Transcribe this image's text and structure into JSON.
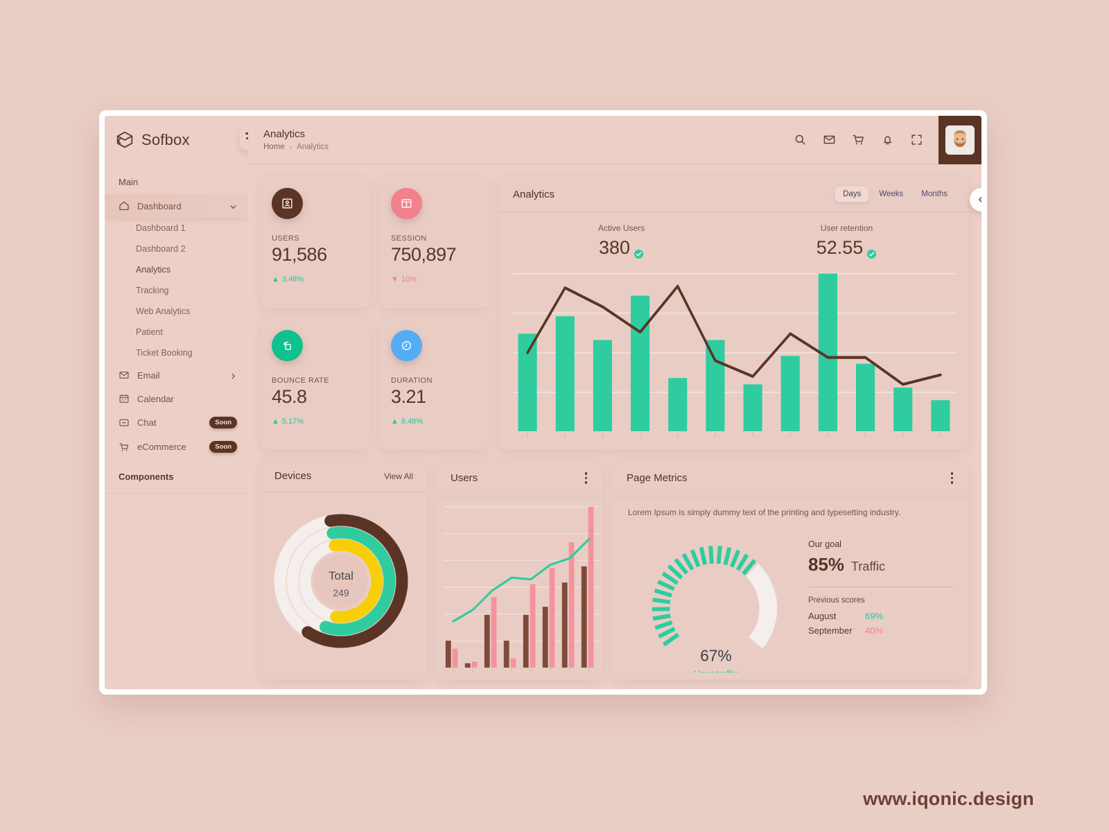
{
  "brand": {
    "name": "Sofbox",
    "logo_icon": "sofbox-logo-icon",
    "collapse_icon": "menu-collapse-icon"
  },
  "sidebar": {
    "section_main": "Main",
    "section_components": "Components",
    "dashboard": {
      "label": "Dashboard",
      "icon": "home-icon",
      "chevron": "chevron-down-icon"
    },
    "sub_items": [
      {
        "label": "Dashboard 1"
      },
      {
        "label": "Dashboard 2"
      },
      {
        "label": "Analytics"
      },
      {
        "label": "Tracking"
      },
      {
        "label": "Web Analytics"
      },
      {
        "label": "Patient"
      },
      {
        "label": "Ticket Booking"
      }
    ],
    "items": [
      {
        "label": "Email",
        "icon": "mail-icon",
        "chevron": "chevron-right-icon",
        "badge": ""
      },
      {
        "label": "Calendar",
        "icon": "calendar-icon",
        "chevron": "",
        "badge": ""
      },
      {
        "label": "Chat",
        "icon": "chat-icon",
        "chevron": "",
        "badge": "Soon"
      },
      {
        "label": "eCommerce",
        "icon": "cart-icon",
        "chevron": "",
        "badge": "Soon"
      }
    ]
  },
  "header": {
    "title": "Analytics",
    "breadcrumb_home": "Home",
    "breadcrumb_sep": "›",
    "breadcrumb_current": "Analytics",
    "icons": [
      "search-icon",
      "mail-icon",
      "cart-icon",
      "bell-icon",
      "fullscreen-icon"
    ],
    "avatar": "user-avatar"
  },
  "kpis": [
    {
      "label": "USERS",
      "value": "91,586",
      "delta": "3.48%",
      "direction": "up",
      "icon": "contact-card-icon",
      "color": "#5b3426"
    },
    {
      "label": "SESSION",
      "value": "750,897",
      "delta": "10%",
      "direction": "down",
      "icon": "browser-window-icon",
      "color": "#f2808d"
    },
    {
      "label": "BOUNCE RATE",
      "value": "45.8",
      "delta": "5.17%",
      "direction": "up",
      "icon": "bounce-icon",
      "color": "#0fc18e"
    },
    {
      "label": "DURATION",
      "value": "3.21",
      "delta": "8.48%",
      "direction": "up",
      "icon": "clock-icon",
      "color": "#54acf5"
    }
  ],
  "analytics": {
    "title": "Analytics",
    "tabs": [
      {
        "label": "Days",
        "active": true
      },
      {
        "label": "Weeks",
        "active": false
      },
      {
        "label": "Months",
        "active": false
      }
    ],
    "active_users_label": "Active Users",
    "active_users_value": "380",
    "retention_label": "User retention",
    "retention_value": "52.55",
    "badge_icon": "check-circle-icon"
  },
  "devices": {
    "title": "Devices",
    "view_all": "View All",
    "center_label": "Total",
    "center_value": "249"
  },
  "users_card": {
    "title": "Users",
    "menu_icon": "kebab-menu-icon"
  },
  "page_metrics": {
    "title": "Page Metrics",
    "menu_icon": "kebab-menu-icon",
    "description": "Lorem Ipsum is simply dummy text of the printing and typesetting industry.",
    "gauge_value": "67%",
    "gauge_caption": "User traffic",
    "goal_label": "Our goal",
    "goal_pct": "85%",
    "goal_word": "Traffic",
    "previous_label": "Previous scores",
    "previous": [
      {
        "month": "August",
        "pct": "69%",
        "tone": "g"
      },
      {
        "month": "September",
        "pct": "40%",
        "tone": "r"
      }
    ]
  },
  "float_arrow_icon": "arrow-left-icon",
  "watermark": "www.iqonic.design",
  "colors": {
    "background": "#e9cec6",
    "panel": "#ecd0c8",
    "card": "#e9cdc5",
    "brown": "#5b3426",
    "green": "#2ecc9f",
    "pink": "#f2808d",
    "yellow": "#f6cf09",
    "blue": "#54acf5",
    "offwhite": "#f4eeec"
  },
  "chart_data": [
    {
      "type": "bar",
      "id": "analytics-main",
      "title": "Analytics",
      "categories": [
        "1",
        "2",
        "3",
        "4",
        "5",
        "6",
        "7",
        "8",
        "9",
        "10",
        "11",
        "12"
      ],
      "series": [
        {
          "name": "Bars",
          "type": "bar",
          "color": "#2ecc9f",
          "values": [
            62,
            73,
            58,
            86,
            34,
            58,
            30,
            48,
            100,
            43,
            28,
            20
          ]
        },
        {
          "name": "Trend",
          "type": "line",
          "color": "#5b3426",
          "values": [
            50,
            91,
            79,
            63,
            92,
            45,
            35,
            62,
            47,
            47,
            30,
            36
          ]
        }
      ],
      "ylim": [
        0,
        100
      ],
      "grid": true,
      "xlabel": "",
      "ylabel": "",
      "legend": "none"
    },
    {
      "type": "pie",
      "id": "devices-rings",
      "title": "Devices",
      "center_label": "Total",
      "center_value": 249,
      "rings": [
        {
          "name": "Outer",
          "color": "#5b3426",
          "track": "#f4eeec",
          "percent": 62
        },
        {
          "name": "Middle",
          "color": "#2ecc9f",
          "track": "#f4eeec",
          "percent": 58
        },
        {
          "name": "Inner",
          "color": "#f6cf09",
          "track": "#f4eeec",
          "percent": 55
        }
      ]
    },
    {
      "type": "bar",
      "id": "users-mini",
      "title": "Users",
      "categories": [
        "1",
        "2",
        "3",
        "4",
        "5",
        "6",
        "7",
        "8"
      ],
      "series": [
        {
          "name": "Brown bars",
          "type": "bar",
          "color": "#7d4b3a",
          "values": [
            17,
            3,
            33,
            17,
            33,
            38,
            53,
            63
          ]
        },
        {
          "name": "Pink bars",
          "type": "bar",
          "color": "#f4939d",
          "values": [
            12,
            4,
            44,
            6,
            52,
            62,
            78,
            100
          ]
        },
        {
          "name": "Line",
          "type": "line",
          "color": "#2ecc9f",
          "values": [
            29,
            36,
            48,
            56,
            55,
            64,
            68,
            80
          ]
        }
      ],
      "ylim": [
        0,
        100
      ],
      "grid": true
    },
    {
      "type": "pie",
      "id": "traffic-gauge",
      "title": "Page Metrics gauge",
      "value": 67,
      "unit": "%",
      "caption": "User traffic",
      "color": "#2ecc9f",
      "track": "#f4eeec",
      "goal": 85,
      "previous_scores": [
        {
          "month": "August",
          "value": 69
        },
        {
          "month": "September",
          "value": 40
        }
      ]
    }
  ]
}
